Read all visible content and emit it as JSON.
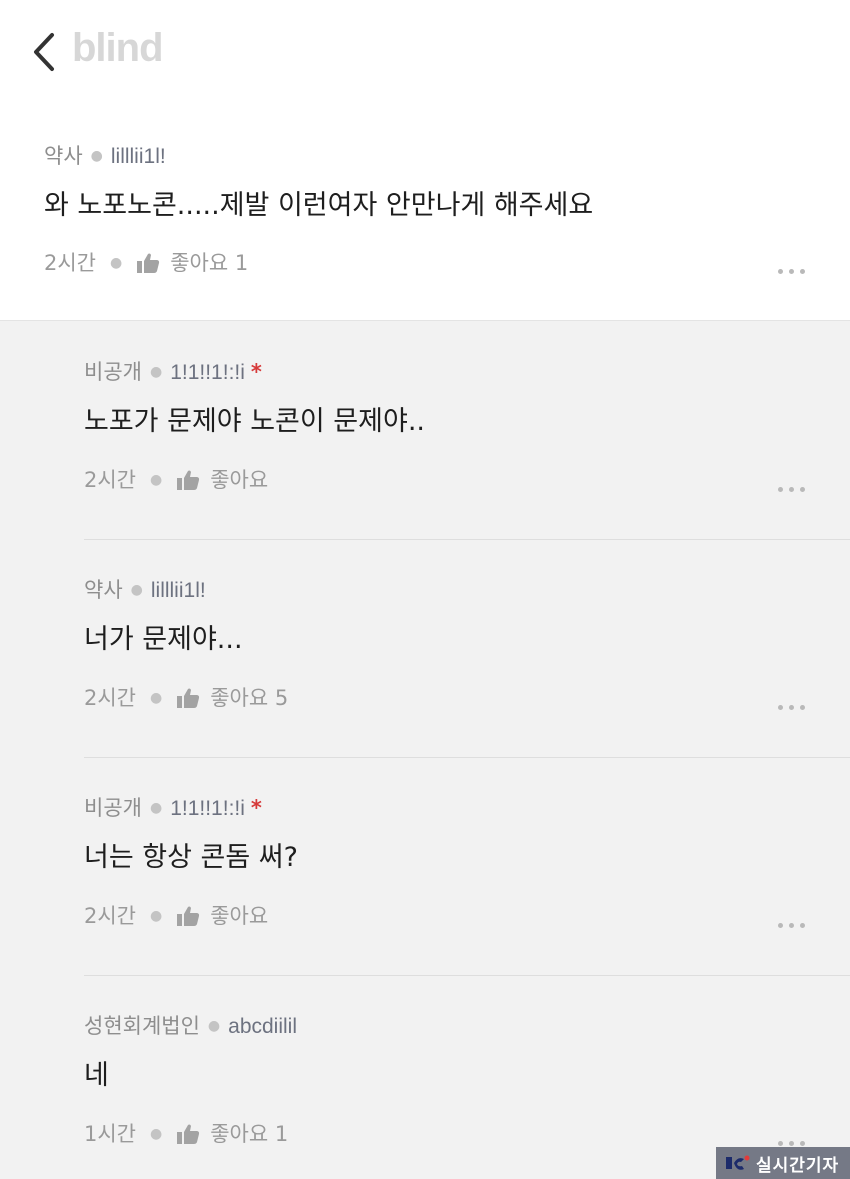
{
  "header": {
    "logo_text": "blind"
  },
  "main_comment": {
    "company": "약사",
    "nickname": "lilllii1l!",
    "content": "와 노포노콘.....제발 이런여자 안만나게 해주세요",
    "time": "2시간",
    "like_label": "좋아요 1"
  },
  "replies": [
    {
      "company": "비공개",
      "nickname": "1!1!!1!:!i",
      "author_mark": "*",
      "content": "노포가 문제야 노콘이 문제야..",
      "time": "2시간",
      "like_label": "좋아요"
    },
    {
      "company": "약사",
      "nickname": "lilllii1l!",
      "author_mark": "",
      "content": "너가 문제야...",
      "time": "2시간",
      "like_label": "좋아요 5"
    },
    {
      "company": "비공개",
      "nickname": "1!1!!1!:!i",
      "author_mark": "*",
      "content": "너는 항상 콘돔 써?",
      "time": "2시간",
      "like_label": "좋아요"
    },
    {
      "company": "성현회계법인",
      "nickname": "abcdiilil",
      "author_mark": "",
      "content": "네",
      "time": "1시간",
      "like_label": "좋아요 1"
    }
  ],
  "watermark": {
    "text": "실시간기자"
  },
  "colors": {
    "op_mark": "#d63a3a",
    "reply_background": "#f2f2f2",
    "logo": "#d7d7d7"
  }
}
